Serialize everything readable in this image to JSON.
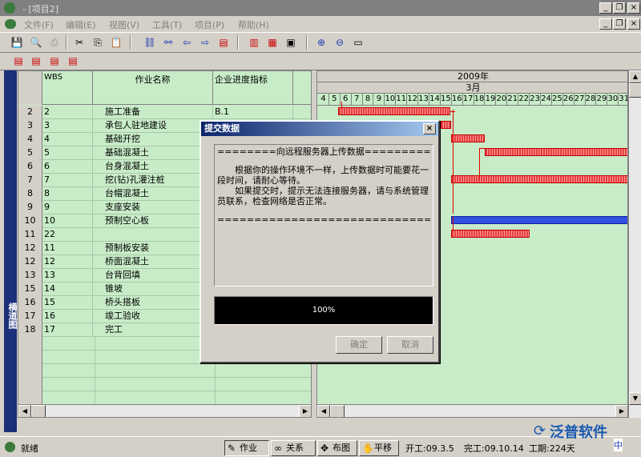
{
  "window": {
    "title": "- [项目2]"
  },
  "menu": [
    "文件(F)",
    "编辑(E)",
    "视图(V)",
    "工具(T)",
    "项目(P)",
    "帮助(H)"
  ],
  "side_tab": "横道图",
  "grid": {
    "headers": {
      "wbs": "WBS",
      "name": "作业名称",
      "progress": "企业进度指标"
    },
    "rows": [
      {
        "n": "2",
        "wbs": "2",
        "name": "施工准备",
        "prog": "B.1"
      },
      {
        "n": "3",
        "wbs": "3",
        "name": "承包人驻地建设",
        "prog": ""
      },
      {
        "n": "4",
        "wbs": "4",
        "name": "基础开挖",
        "prog": ""
      },
      {
        "n": "5",
        "wbs": "5",
        "name": "基础混凝土",
        "prog": ""
      },
      {
        "n": "6",
        "wbs": "6",
        "name": "台身混凝土",
        "prog": ""
      },
      {
        "n": "7",
        "wbs": "7",
        "name": "挖(钻)孔灌注桩",
        "prog": ""
      },
      {
        "n": "8",
        "wbs": "8",
        "name": "台帽混凝土",
        "prog": ""
      },
      {
        "n": "9",
        "wbs": "9",
        "name": "支座安装",
        "prog": ""
      },
      {
        "n": "10",
        "wbs": "10",
        "name": "预制空心板",
        "prog": ""
      },
      {
        "n": "11",
        "wbs": "22",
        "name": "",
        "prog": ""
      },
      {
        "n": "12",
        "wbs": "11",
        "name": "预制板安装",
        "prog": ""
      },
      {
        "n": "12",
        "wbs": "12",
        "name": "桥面混凝土",
        "prog": ""
      },
      {
        "n": "13",
        "wbs": "13",
        "name": "台背回填",
        "prog": ""
      },
      {
        "n": "15",
        "wbs": "14",
        "name": "锥坡",
        "prog": ""
      },
      {
        "n": "16",
        "wbs": "15",
        "name": "桥头搭板",
        "prog": ""
      },
      {
        "n": "17",
        "wbs": "16",
        "name": "竣工验收",
        "prog": ""
      },
      {
        "n": "18",
        "wbs": "17",
        "name": "完工",
        "prog": ""
      }
    ]
  },
  "gantt": {
    "year": "2009年",
    "month": "3月",
    "days": [
      "4",
      "5",
      "6",
      "7",
      "8",
      "9",
      "10",
      "11",
      "12",
      "13",
      "14",
      "15",
      "16",
      "17",
      "18",
      "19",
      "20",
      "21",
      "22",
      "23",
      "24",
      "25",
      "26",
      "27",
      "28",
      "29",
      "30",
      "31"
    ]
  },
  "dialog": {
    "title": "提交数据",
    "close": "×",
    "message_head": "========向远程服务器上传数据================",
    "message_body": "根据你的操作环境不一样，上传数据时可能要花一段时间，请耐心等待。",
    "message_body2": "如果提交时，提示无法连接服务器，请与系统管理员联系，检查网络是否正常。",
    "message_tail": "============================================",
    "progress_text": "100%",
    "ok": "确定",
    "cancel": "取消"
  },
  "status": {
    "ready": "就绪",
    "tabs": [
      {
        "label": "作业",
        "icon": "✎"
      },
      {
        "label": "关系",
        "icon": "∞"
      },
      {
        "label": "布图",
        "icon": "✥"
      },
      {
        "label": "平移",
        "icon": "✋"
      }
    ],
    "start": "开工:09.3.5",
    "end": "完工:09.10.14",
    "duration": "工期:224天"
  },
  "logo_text": "泛普软件",
  "ime": "中"
}
